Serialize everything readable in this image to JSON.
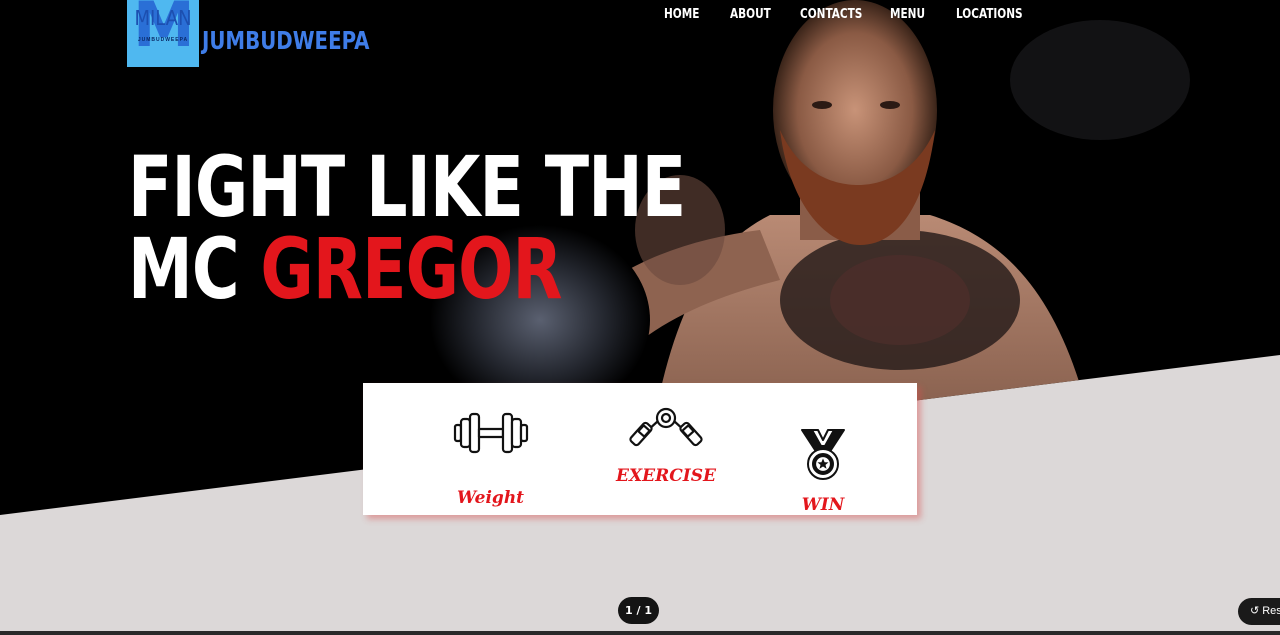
{
  "header": {
    "logo_word": "MILAN",
    "logo_tagline": "JUMBUDWEEPA",
    "brand": "JUMBUDWEEPA"
  },
  "nav": {
    "items": [
      {
        "label": "HOME"
      },
      {
        "label": "ABOUT"
      },
      {
        "label": "CONTACTS"
      },
      {
        "label": "MENU"
      },
      {
        "label": "LOCATIONS"
      }
    ]
  },
  "hero": {
    "line1": "FIGHT LIKE THE",
    "line2_white": "MC ",
    "line2_red": "GREGOR"
  },
  "features": [
    {
      "label": "Weight",
      "icon": "dumbbell-icon"
    },
    {
      "label": "EXERCISE",
      "icon": "hand-gripper-icon"
    },
    {
      "label": "WIN",
      "icon": "medal-icon"
    }
  ],
  "pager": {
    "text": "1 / 1"
  },
  "reset": {
    "label": "Res"
  },
  "colors": {
    "accent_red": "#e3161c",
    "brand_blue": "#3f7de8",
    "logo_bg": "#4fb8f0",
    "hero_bg": "#000000",
    "page_bg": "#dcd8d8"
  }
}
